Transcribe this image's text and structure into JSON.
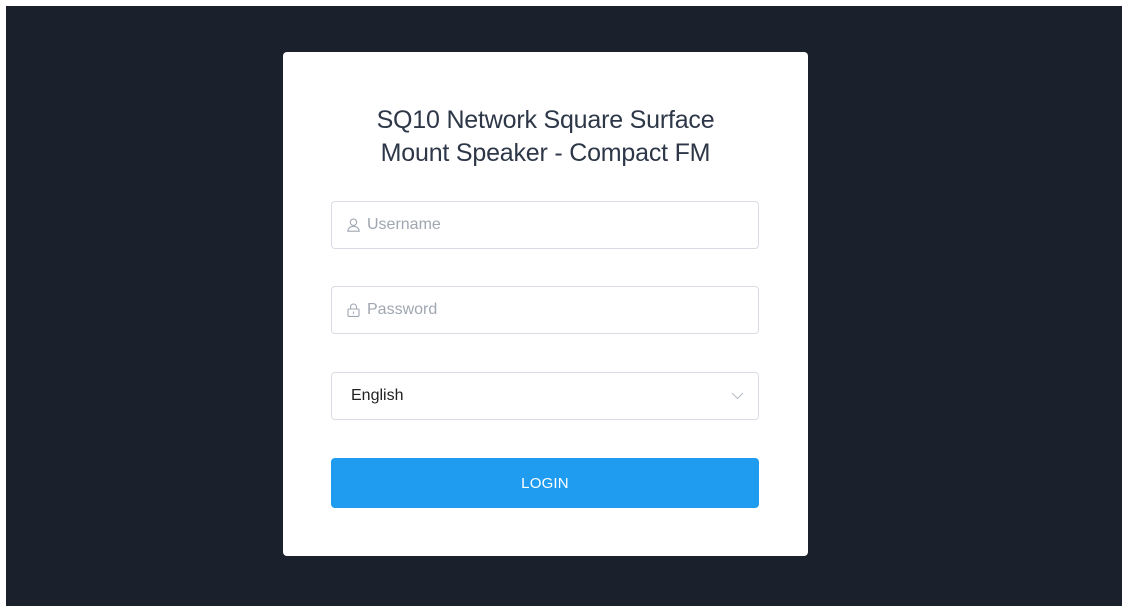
{
  "login": {
    "title_line1": "SQ10 Network Square Surface",
    "title_line2": "Mount Speaker - Compact FM",
    "username": {
      "placeholder": "Username",
      "value": "",
      "icon": "user-icon"
    },
    "password": {
      "placeholder": "Password",
      "value": "",
      "icon": "lock-icon"
    },
    "language": {
      "selected": "English",
      "icon": "chevron-down-icon"
    },
    "login_label": "LOGIN"
  },
  "colors": {
    "background": "#1a202c",
    "card": "#ffffff",
    "primary_button": "#1f9cf0",
    "placeholder": "#a0a7b1",
    "border": "#d9dde3"
  }
}
